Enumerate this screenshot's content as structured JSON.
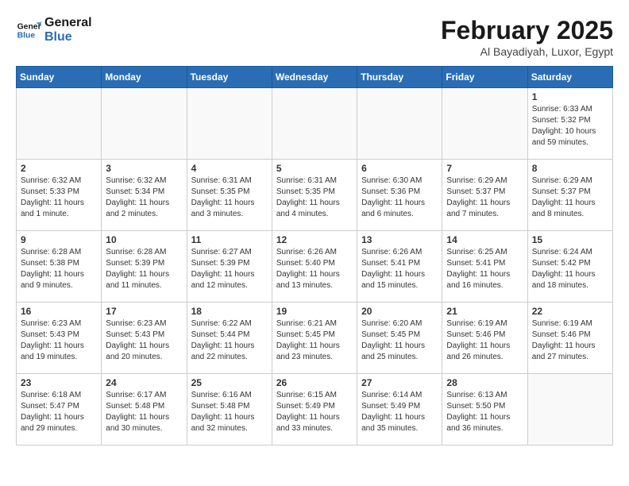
{
  "logo": {
    "line1": "General",
    "line2": "Blue"
  },
  "title": "February 2025",
  "subtitle": "Al Bayadiyah, Luxor, Egypt",
  "days_of_week": [
    "Sunday",
    "Monday",
    "Tuesday",
    "Wednesday",
    "Thursday",
    "Friday",
    "Saturday"
  ],
  "weeks": [
    [
      {
        "day": "",
        "info": ""
      },
      {
        "day": "",
        "info": ""
      },
      {
        "day": "",
        "info": ""
      },
      {
        "day": "",
        "info": ""
      },
      {
        "day": "",
        "info": ""
      },
      {
        "day": "",
        "info": ""
      },
      {
        "day": "1",
        "info": "Sunrise: 6:33 AM\nSunset: 5:32 PM\nDaylight: 10 hours and 59 minutes."
      }
    ],
    [
      {
        "day": "2",
        "info": "Sunrise: 6:32 AM\nSunset: 5:33 PM\nDaylight: 11 hours and 1 minute."
      },
      {
        "day": "3",
        "info": "Sunrise: 6:32 AM\nSunset: 5:34 PM\nDaylight: 11 hours and 2 minutes."
      },
      {
        "day": "4",
        "info": "Sunrise: 6:31 AM\nSunset: 5:35 PM\nDaylight: 11 hours and 3 minutes."
      },
      {
        "day": "5",
        "info": "Sunrise: 6:31 AM\nSunset: 5:35 PM\nDaylight: 11 hours and 4 minutes."
      },
      {
        "day": "6",
        "info": "Sunrise: 6:30 AM\nSunset: 5:36 PM\nDaylight: 11 hours and 6 minutes."
      },
      {
        "day": "7",
        "info": "Sunrise: 6:29 AM\nSunset: 5:37 PM\nDaylight: 11 hours and 7 minutes."
      },
      {
        "day": "8",
        "info": "Sunrise: 6:29 AM\nSunset: 5:37 PM\nDaylight: 11 hours and 8 minutes."
      }
    ],
    [
      {
        "day": "9",
        "info": "Sunrise: 6:28 AM\nSunset: 5:38 PM\nDaylight: 11 hours and 9 minutes."
      },
      {
        "day": "10",
        "info": "Sunrise: 6:28 AM\nSunset: 5:39 PM\nDaylight: 11 hours and 11 minutes."
      },
      {
        "day": "11",
        "info": "Sunrise: 6:27 AM\nSunset: 5:39 PM\nDaylight: 11 hours and 12 minutes."
      },
      {
        "day": "12",
        "info": "Sunrise: 6:26 AM\nSunset: 5:40 PM\nDaylight: 11 hours and 13 minutes."
      },
      {
        "day": "13",
        "info": "Sunrise: 6:26 AM\nSunset: 5:41 PM\nDaylight: 11 hours and 15 minutes."
      },
      {
        "day": "14",
        "info": "Sunrise: 6:25 AM\nSunset: 5:41 PM\nDaylight: 11 hours and 16 minutes."
      },
      {
        "day": "15",
        "info": "Sunrise: 6:24 AM\nSunset: 5:42 PM\nDaylight: 11 hours and 18 minutes."
      }
    ],
    [
      {
        "day": "16",
        "info": "Sunrise: 6:23 AM\nSunset: 5:43 PM\nDaylight: 11 hours and 19 minutes."
      },
      {
        "day": "17",
        "info": "Sunrise: 6:23 AM\nSunset: 5:43 PM\nDaylight: 11 hours and 20 minutes."
      },
      {
        "day": "18",
        "info": "Sunrise: 6:22 AM\nSunset: 5:44 PM\nDaylight: 11 hours and 22 minutes."
      },
      {
        "day": "19",
        "info": "Sunrise: 6:21 AM\nSunset: 5:45 PM\nDaylight: 11 hours and 23 minutes."
      },
      {
        "day": "20",
        "info": "Sunrise: 6:20 AM\nSunset: 5:45 PM\nDaylight: 11 hours and 25 minutes."
      },
      {
        "day": "21",
        "info": "Sunrise: 6:19 AM\nSunset: 5:46 PM\nDaylight: 11 hours and 26 minutes."
      },
      {
        "day": "22",
        "info": "Sunrise: 6:19 AM\nSunset: 5:46 PM\nDaylight: 11 hours and 27 minutes."
      }
    ],
    [
      {
        "day": "23",
        "info": "Sunrise: 6:18 AM\nSunset: 5:47 PM\nDaylight: 11 hours and 29 minutes."
      },
      {
        "day": "24",
        "info": "Sunrise: 6:17 AM\nSunset: 5:48 PM\nDaylight: 11 hours and 30 minutes."
      },
      {
        "day": "25",
        "info": "Sunrise: 6:16 AM\nSunset: 5:48 PM\nDaylight: 11 hours and 32 minutes."
      },
      {
        "day": "26",
        "info": "Sunrise: 6:15 AM\nSunset: 5:49 PM\nDaylight: 11 hours and 33 minutes."
      },
      {
        "day": "27",
        "info": "Sunrise: 6:14 AM\nSunset: 5:49 PM\nDaylight: 11 hours and 35 minutes."
      },
      {
        "day": "28",
        "info": "Sunrise: 6:13 AM\nSunset: 5:50 PM\nDaylight: 11 hours and 36 minutes."
      },
      {
        "day": "",
        "info": ""
      }
    ]
  ]
}
